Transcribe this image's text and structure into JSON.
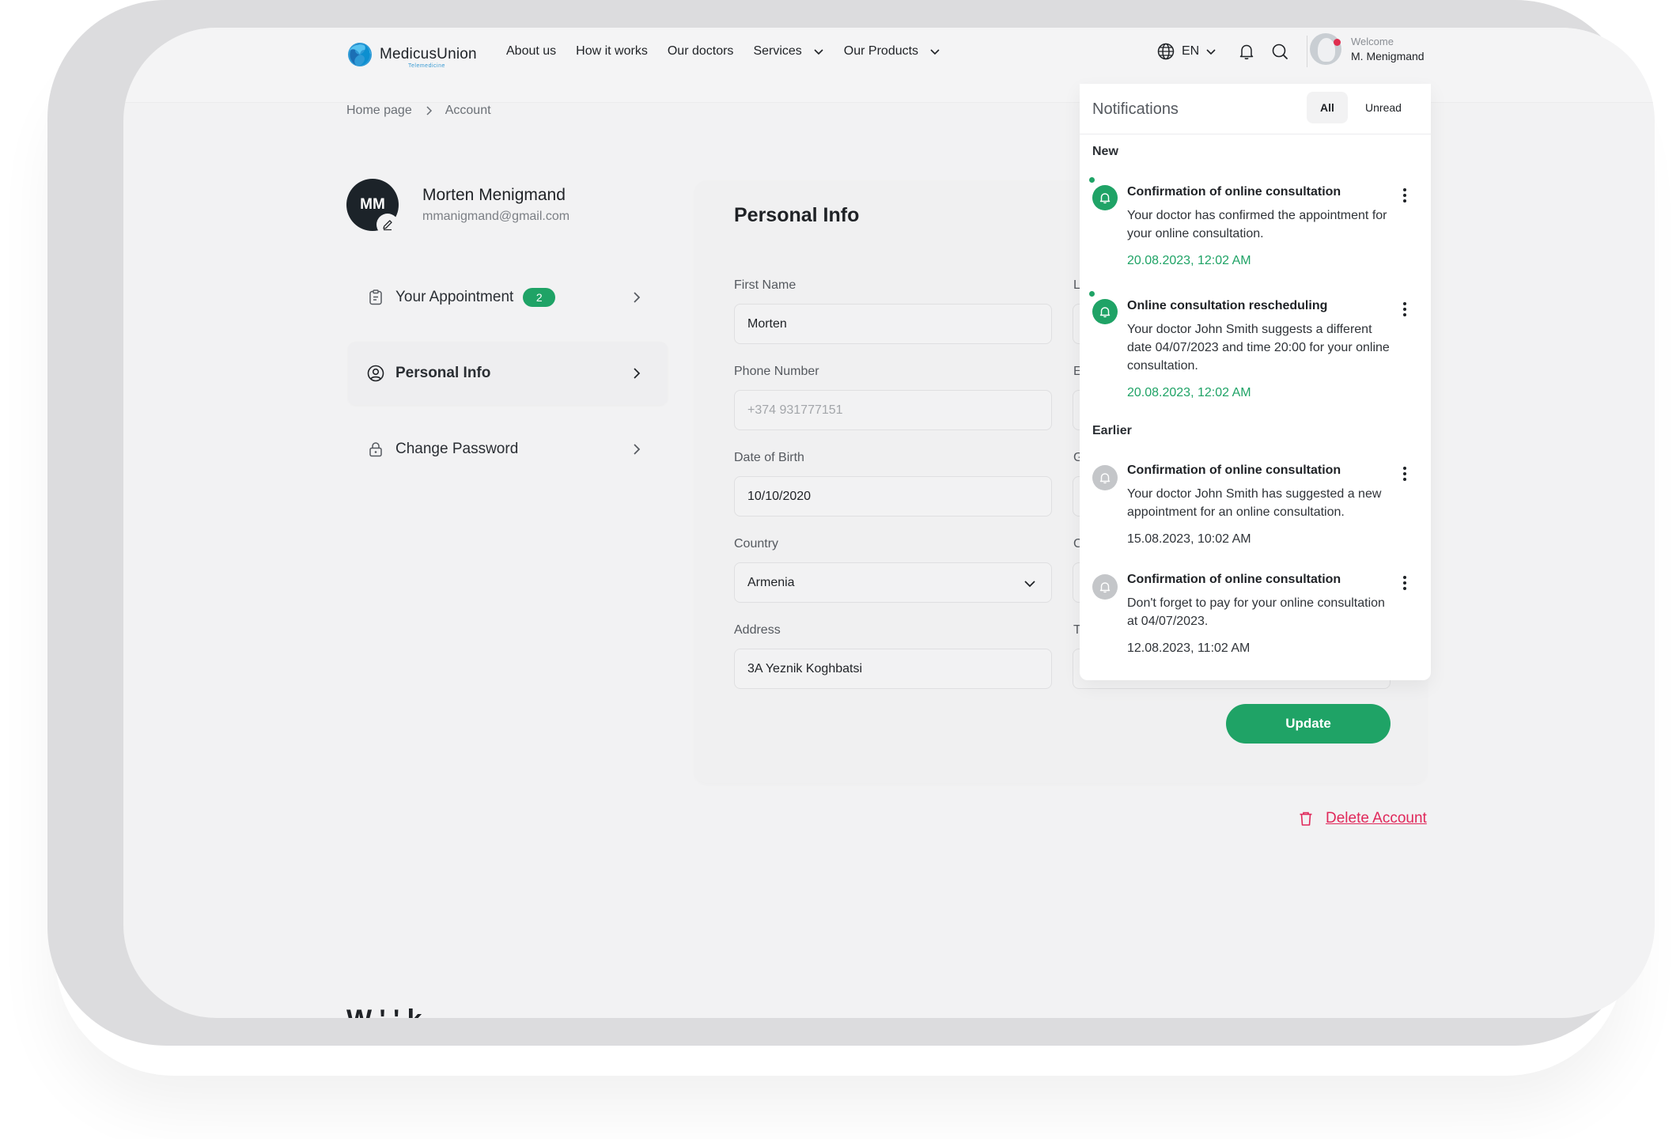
{
  "brand": {
    "name": "MedicusUnion",
    "tagline": "Telemedicine"
  },
  "nav": {
    "items": [
      {
        "label": "About us"
      },
      {
        "label": "How it works"
      },
      {
        "label": "Our doctors"
      },
      {
        "label": "Services"
      },
      {
        "label": "Our Products"
      }
    ],
    "language": "EN"
  },
  "user": {
    "welcome": "Welcome",
    "name": "M. Menigmand"
  },
  "breadcrumb": {
    "home": "Home page",
    "current": "Account"
  },
  "profile": {
    "initials": "MM",
    "full_name": "Morten Menigmand",
    "email": "mmanigmand@gmail.com"
  },
  "sidebar": {
    "items": [
      {
        "label": "Your Appointment",
        "badge": "2"
      },
      {
        "label": "Personal Info"
      },
      {
        "label": "Change Password"
      }
    ]
  },
  "form": {
    "title": "Personal Info",
    "first_name": {
      "label": "First Name",
      "value": "Morten"
    },
    "phone": {
      "label": "Phone Number",
      "placeholder": "+374 931777151"
    },
    "dob": {
      "label": "Date of Birth",
      "value": "10/10/2020"
    },
    "country": {
      "label": "Country",
      "value": "Armenia"
    },
    "address": {
      "label": "Address",
      "value": "3A Yeznik Koghbatsi"
    },
    "right_labels": [
      "L",
      "E",
      "G",
      "C",
      "T"
    ],
    "update_label": "Update"
  },
  "delete_label": "Delete Account",
  "footer_cut_text": "W      '        '   k",
  "notifications": {
    "title": "Notifications",
    "tabs": [
      "All",
      "Unread"
    ],
    "new_label": "New",
    "earlier_label": "Earlier",
    "items": [
      {
        "title": "Confirmation of online consultation",
        "body": "Your doctor has confirmed the appointment for your online consultation.",
        "time": "20.08.2023, 12:02 AM"
      },
      {
        "title": "Online consultation rescheduling",
        "body": "Your doctor John Smith suggests a different date 04/07/2023 and time 20:00 for your online consultation.",
        "time": "20.08.2023, 12:02 AM"
      },
      {
        "title": "Confirmation of online consultation",
        "body": "Your doctor John Smith has suggested a new appointment for an online consultation.",
        "time": "15.08.2023, 10:02 AM"
      },
      {
        "title": "Confirmation of online consultation",
        "body": "Don't forget to pay for your online consultation at 04/07/2023.",
        "time": "12.08.2023, 11:02 AM"
      }
    ]
  },
  "colors": {
    "accent": "#1fa366",
    "danger": "#e0285a",
    "dark": "#1c2329"
  }
}
